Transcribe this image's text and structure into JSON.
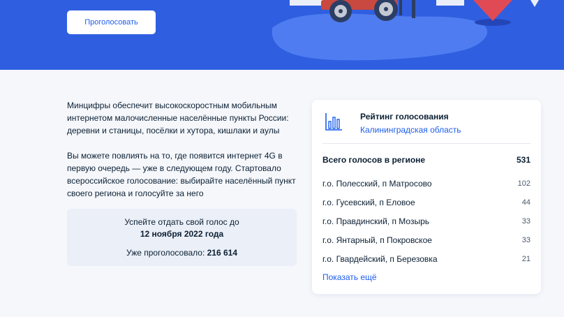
{
  "hero": {
    "vote_button": "Проголосовать",
    "bg_color": "#2f5fe0"
  },
  "description": {
    "p1": "Минцифры обеспечит высокоскоростным мобильным интернетом малочисленные населённые пункты России: деревни и станицы, посёлки и хутора, кишлаки и аулы",
    "p2": "Вы можете повлиять на то, где появится интернет 4G в первую очередь — уже в следующем году. Стартовало всероссийское голосование: выбирайте населённый пункт своего региона и голосуйте за него"
  },
  "deadline": {
    "line1": "Успейте отдать свой голос до",
    "date": "12 ноября 2022 года",
    "voted_label": "Уже проголосовало:",
    "voted_count": "216 614"
  },
  "rating": {
    "icon": "bar-chart-icon",
    "title": "Рейтинг голосования",
    "region": "Калининградская область",
    "total_label": "Всего голосов в регионе",
    "total_value": "531",
    "rows": [
      {
        "name": "г.о. Полесский, п Матросово",
        "votes": "102"
      },
      {
        "name": "г.о. Гусевский, п Еловое",
        "votes": "44"
      },
      {
        "name": "г.о. Правдинский, п Мозырь",
        "votes": "33"
      },
      {
        "name": "г.о. Янтарный, п Покровское",
        "votes": "33"
      },
      {
        "name": "г.о. Гвардейский, п Березовка",
        "votes": "21"
      }
    ],
    "show_more": "Показать ещё"
  },
  "colors": {
    "accent": "#1d5deb",
    "text": "#0b1f33"
  }
}
